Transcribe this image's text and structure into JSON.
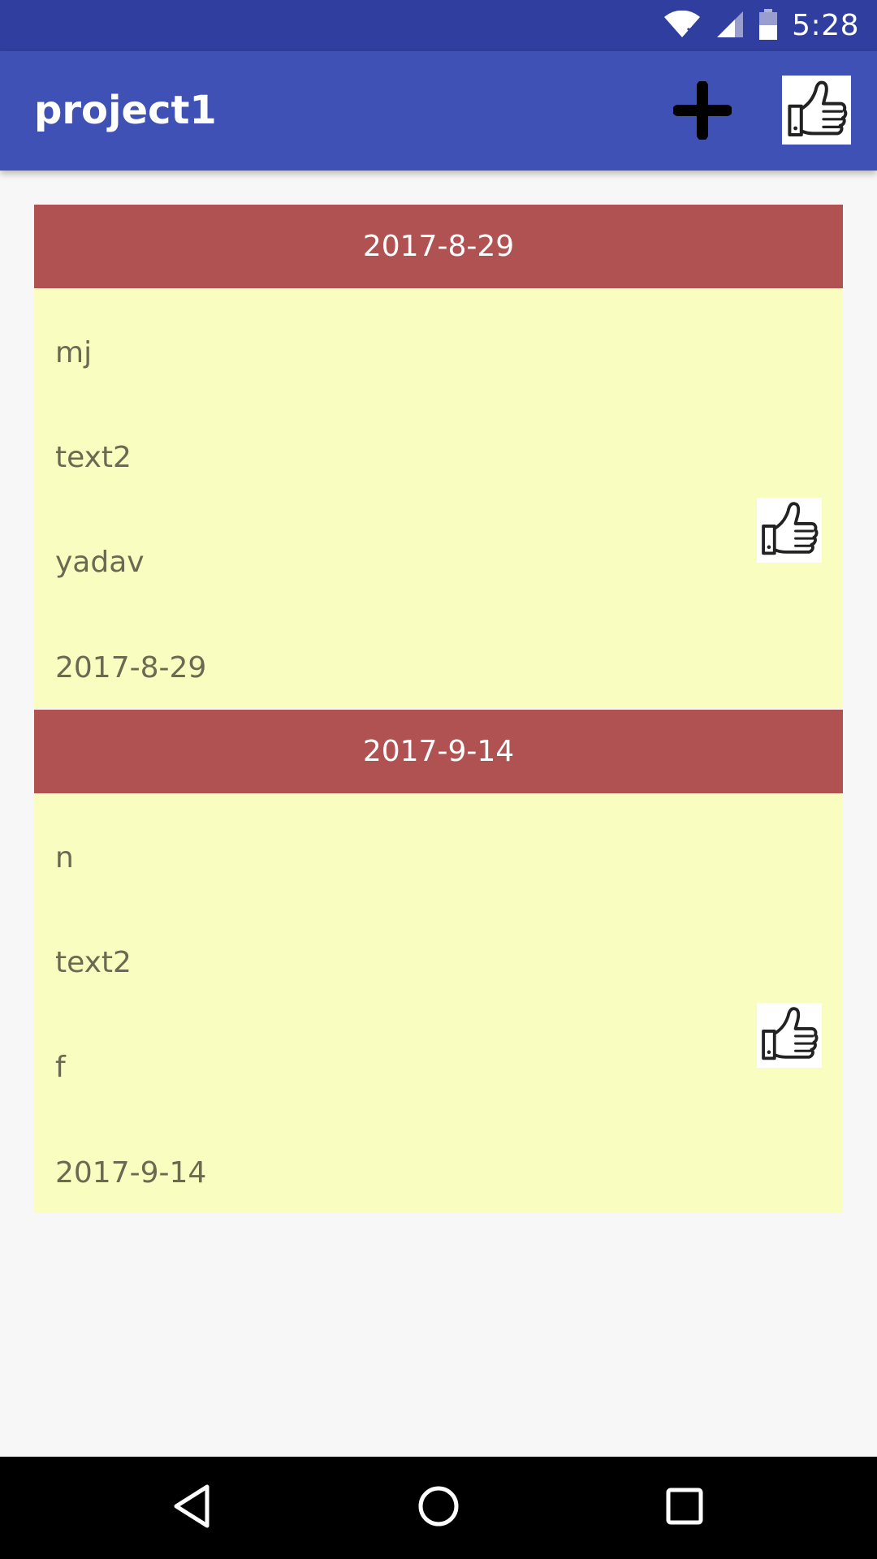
{
  "status_bar": {
    "time": "5:28",
    "icons": [
      "wifi-icon",
      "signal-icon",
      "battery-icon"
    ],
    "background": "#303f9f"
  },
  "app_bar": {
    "title": "project1",
    "background": "#3f51b5",
    "actions": [
      "add-icon",
      "thumbs-up-icon"
    ]
  },
  "entries": [
    {
      "header": "2017-8-29",
      "line1": "mj",
      "line2": "text2",
      "line3": "yadav",
      "line4": "2017-8-29"
    },
    {
      "header": "2017-9-14",
      "line1": "n",
      "line2": "text2",
      "line3": "f",
      "line4": "2017-9-14"
    }
  ],
  "colors": {
    "card_header": "#b05252",
    "card_body": "#f9fdc0",
    "body_text": "#6a6a52"
  },
  "nav_bar": {
    "buttons": [
      "back-icon",
      "home-icon",
      "recents-icon"
    ]
  }
}
